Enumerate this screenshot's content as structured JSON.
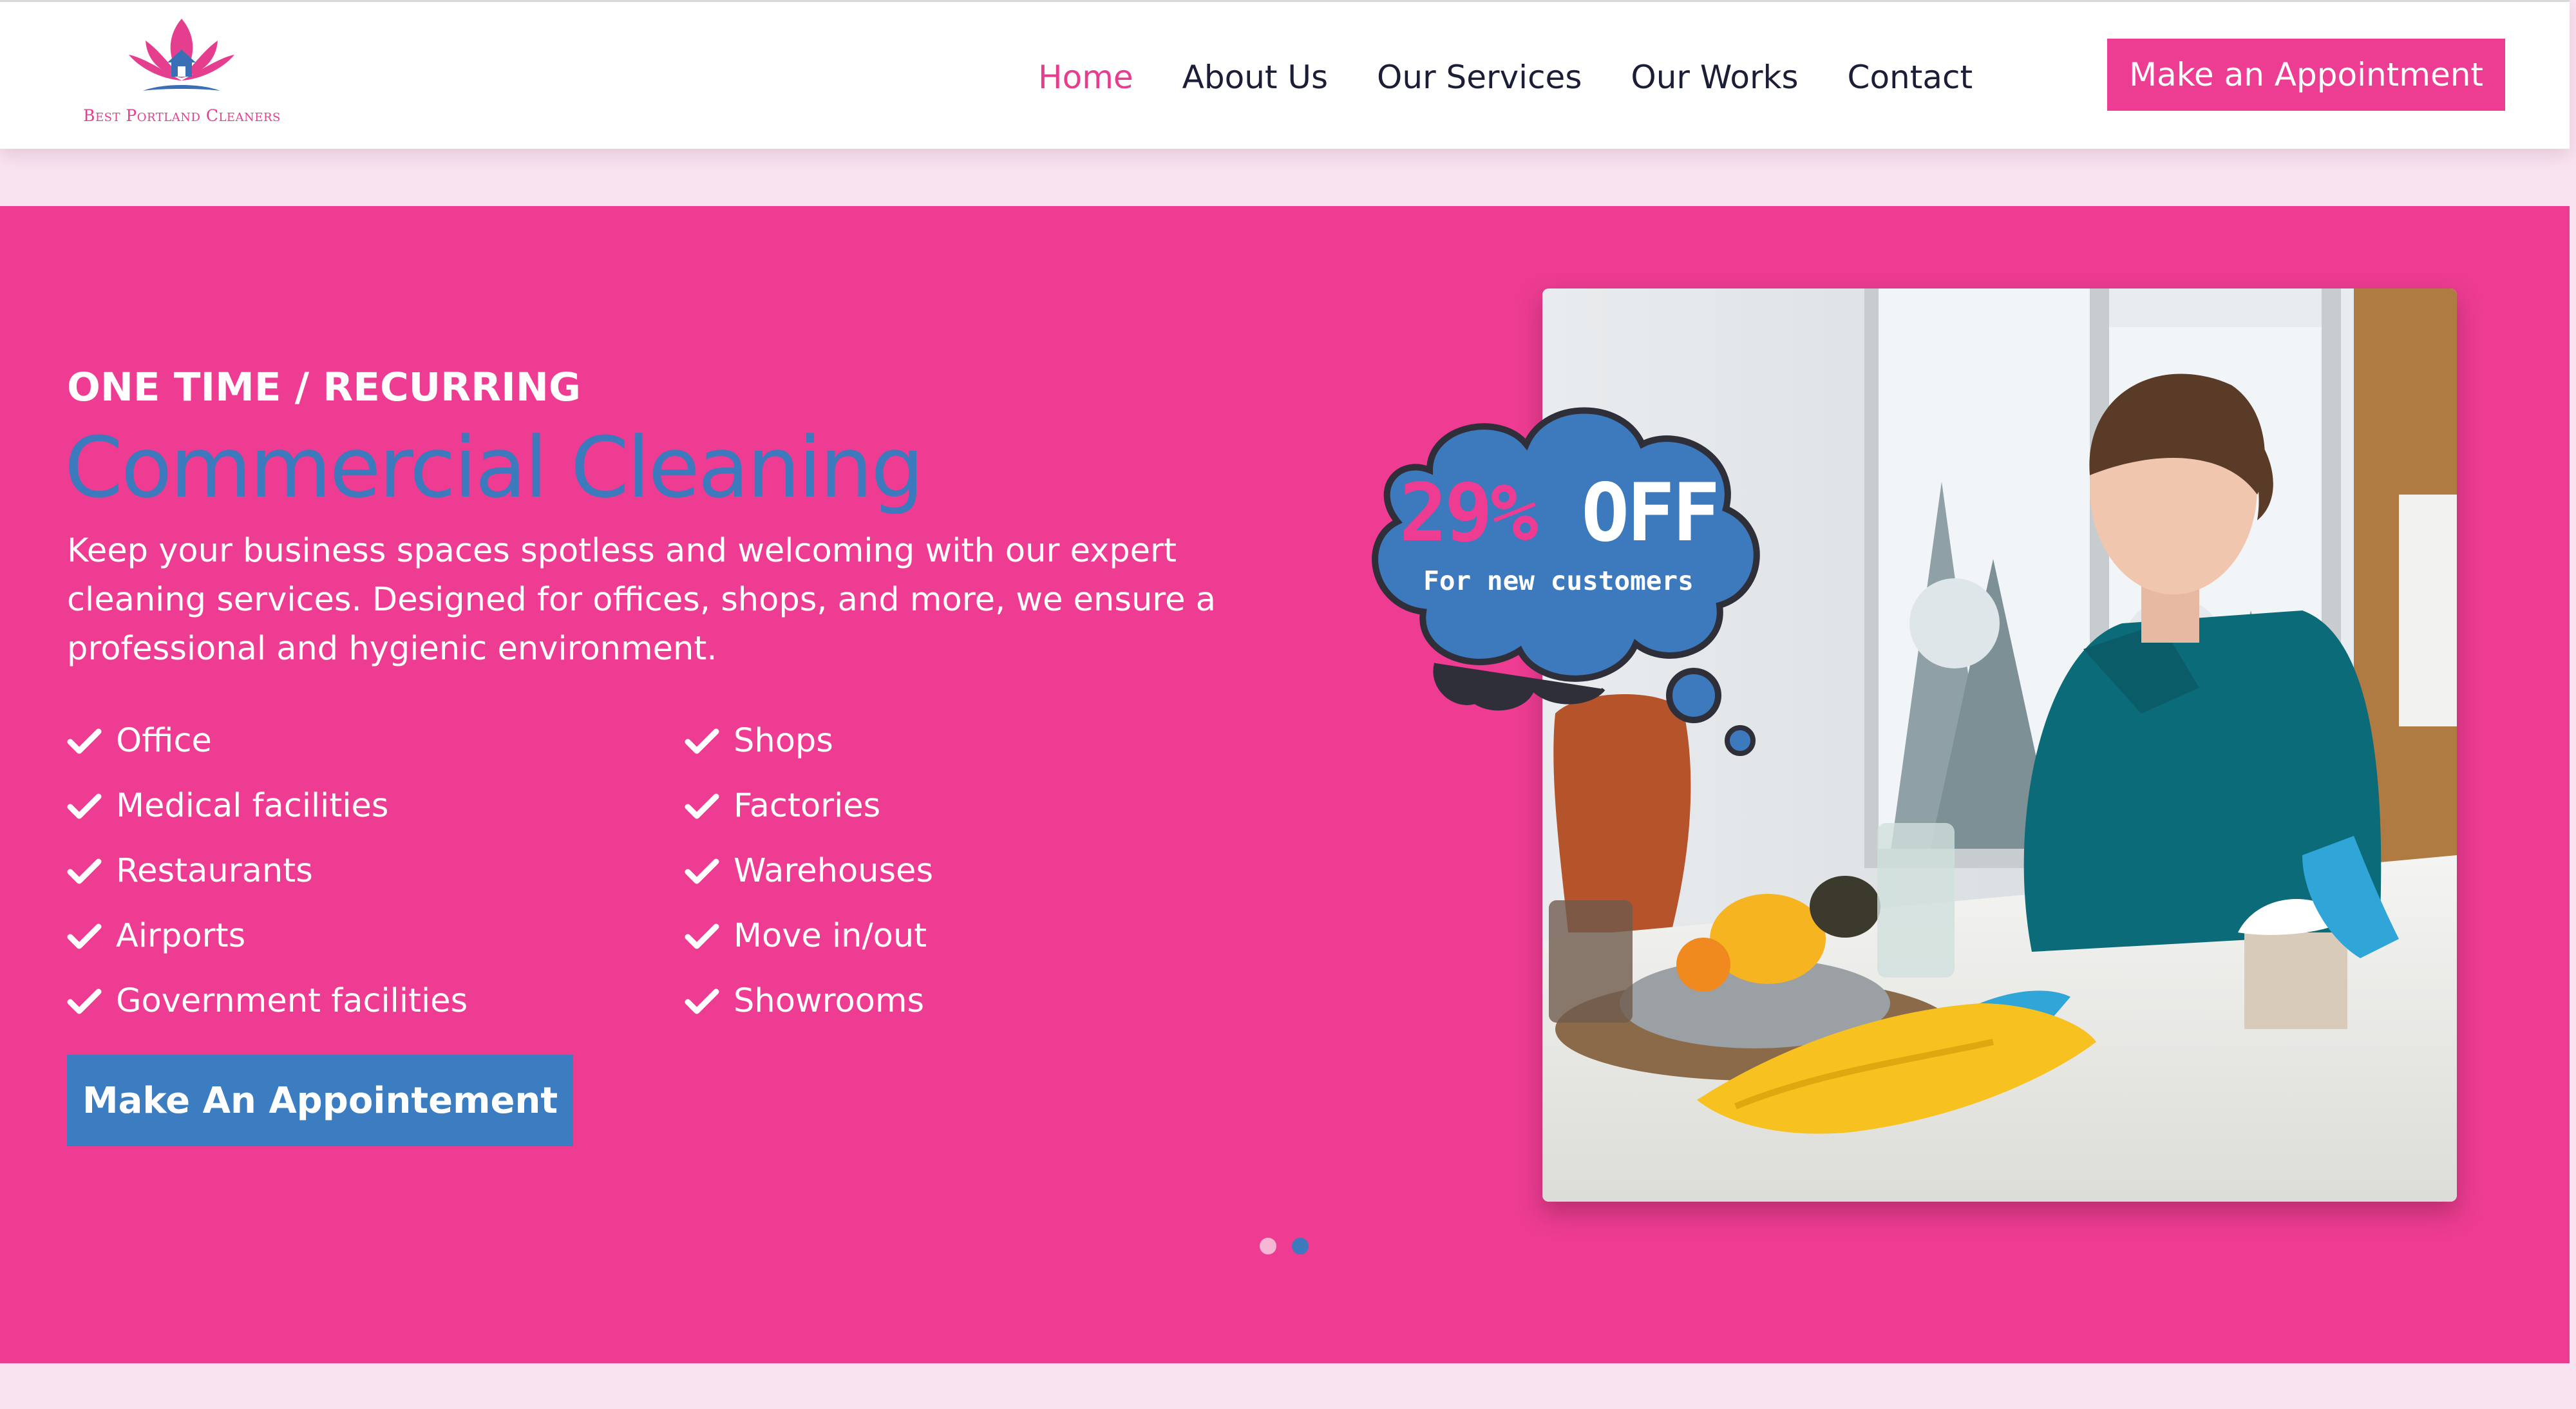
{
  "brand": {
    "logo_text": "Best Portland Cleaners",
    "colors": {
      "pink": "#ec3d93",
      "blue": "#3c79bd",
      "nav_text": "#1b1e36"
    }
  },
  "nav": {
    "items": [
      {
        "label": "Home",
        "active": true
      },
      {
        "label": "About Us",
        "active": false
      },
      {
        "label": "Our Services",
        "active": false
      },
      {
        "label": "Our Works",
        "active": false
      },
      {
        "label": "Contact",
        "active": false
      }
    ],
    "cta_label": "Make an Appointment"
  },
  "hero": {
    "eyebrow": "ONE TIME / RECURRING",
    "headline": "Commercial Cleaning",
    "description": "Keep your business spaces spotless and welcoming with our expert cleaning services. Designed for offices, shops, and more, we ensure a professional and hygienic environment.",
    "list_left": [
      "Office",
      "Medical facilities",
      "Restaurants",
      "Airports",
      "Government facilities"
    ],
    "list_right": [
      "Shops",
      "Factories",
      "Warehouses",
      "Move in/out",
      "Showrooms"
    ],
    "cta_label": "Make An Appointement",
    "promo": {
      "percent": "29%",
      "off": "OFF",
      "subtitle": "For new customers"
    },
    "carousel": {
      "slides": 2,
      "active_slide": 2
    }
  }
}
